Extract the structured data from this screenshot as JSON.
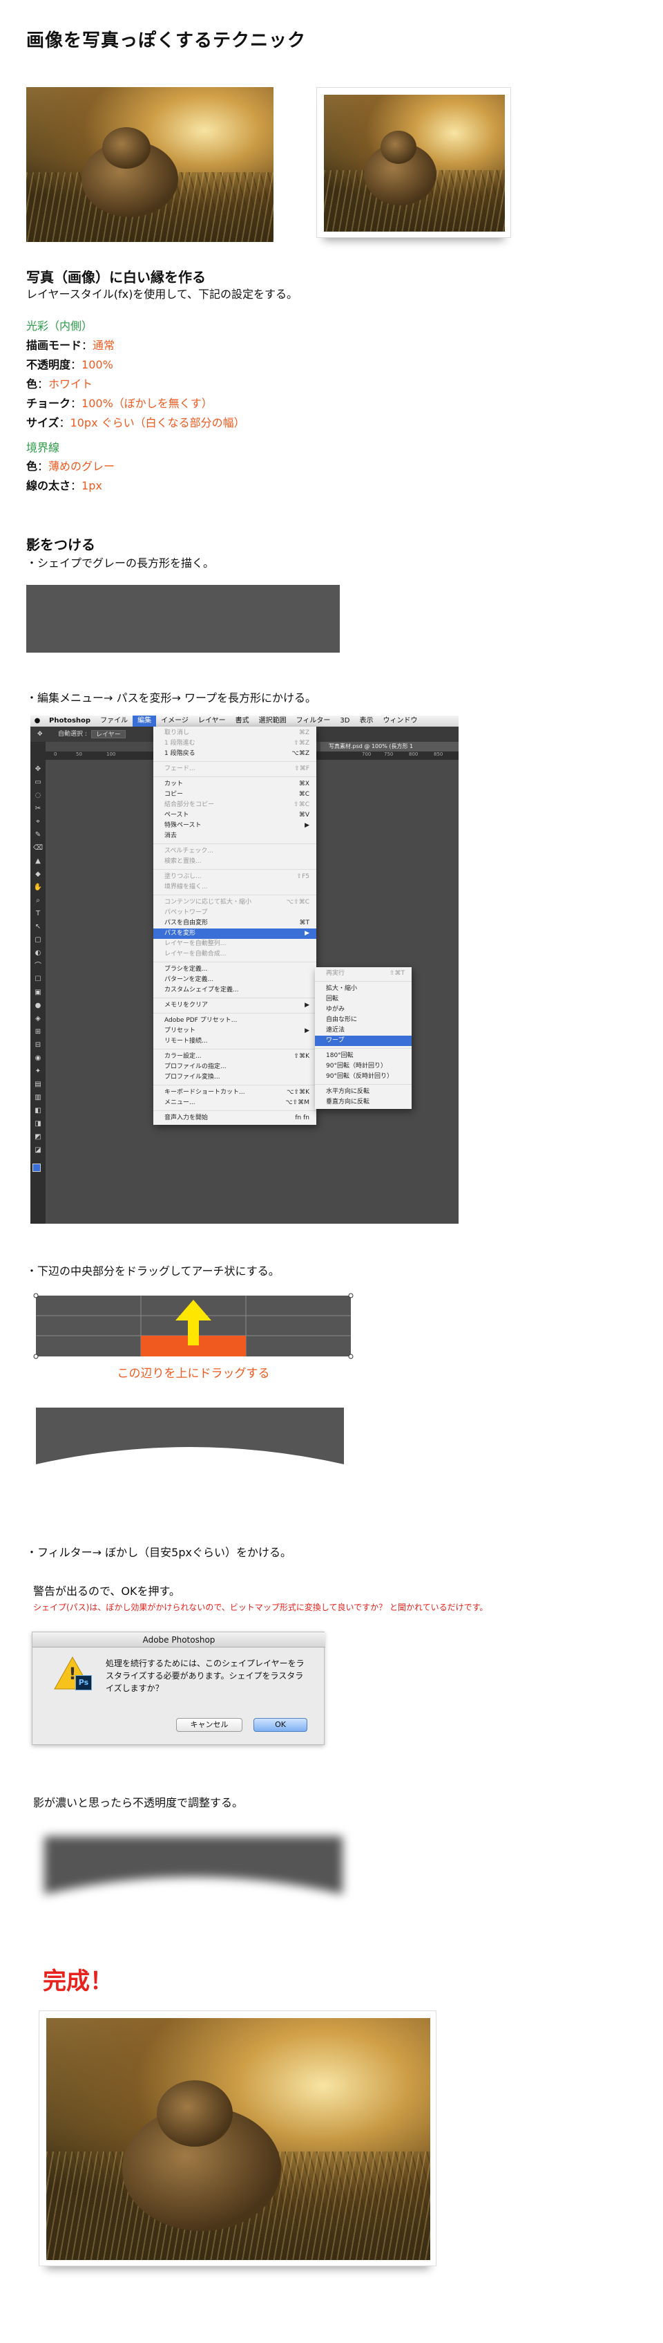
{
  "title": "画像を写真っぽくするテクニック",
  "sec1": {
    "heading": "写真（画像）に白い縁を作る",
    "intro": "レイヤースタイル(fx)を使用して、下記の設定をする。",
    "group1_title": "光彩（内側）",
    "rows1": [
      {
        "label": "描画モード",
        "value": "通常"
      },
      {
        "label": "不透明度",
        "value": "100%"
      },
      {
        "label": "色",
        "value": "ホワイト"
      },
      {
        "label": "チョーク",
        "value": "100%（ぼかしを無くす）"
      },
      {
        "label": "サイズ",
        "value": "10px ぐらい（白くなる部分の幅）"
      }
    ],
    "group2_title": "境界線",
    "rows2": [
      {
        "label": "色",
        "value": "薄めのグレー"
      },
      {
        "label": "線の太さ",
        "value": "1px"
      }
    ],
    "colon": "："
  },
  "sec2": {
    "heading": "影をつける",
    "step1": "・シェイプでグレーの長方形を描く。",
    "step2": "・編集メニュー→ パスを変形→ ワープを長方形にかける。",
    "step3": "・下辺の中央部分をドラッグしてアーチ状にする。",
    "drag_label": "この辺りを上にドラッグする",
    "step4": "・フィルター→ ぼかし（目安5pxぐらい）をかける。",
    "warn1": "警告が出るので、OKを押す。",
    "warn2": "シェイプ(パス)は、ぼかし効果がかけられないので、ビットマップ形式に変換して良いですか？ と聞かれているだけです。",
    "step5": "影が濃いと思ったら不透明度で調整する。",
    "done": "完成！"
  },
  "ps": {
    "menubar": [
      "Photoshop",
      "ファイル",
      "編集",
      "イメージ",
      "レイヤー",
      "書式",
      "選択範囲",
      "フィルター",
      "3D",
      "表示",
      "ウィンドウ"
    ],
    "doc_tab": "写真素材.psd @ 100% (長方形 1",
    "options_label": "自動選択 :",
    "options_value": "レイヤー",
    "ruler": [
      "0",
      "50",
      "100",
      "700",
      "750",
      "800",
      "850"
    ],
    "edit_menu": [
      {
        "label": "取り消し",
        "key": "⌘Z",
        "dim": true
      },
      {
        "label": "1 段階進む",
        "key": "⇧⌘Z",
        "dim": true
      },
      {
        "label": "1 段階戻る",
        "key": "⌥⌘Z",
        "dim": false
      },
      {
        "sep": true
      },
      {
        "label": "フェード...",
        "key": "⇧⌘F",
        "dim": true
      },
      {
        "sep": true
      },
      {
        "label": "カット",
        "key": "⌘X",
        "dim": false
      },
      {
        "label": "コピー",
        "key": "⌘C",
        "dim": false
      },
      {
        "label": "結合部分をコピー",
        "key": "⇧⌘C",
        "dim": true
      },
      {
        "label": "ペースト",
        "key": "⌘V",
        "dim": false
      },
      {
        "label": "特殊ペースト",
        "key": "▶",
        "dim": false
      },
      {
        "label": "消去",
        "key": "",
        "dim": false
      },
      {
        "sep": true
      },
      {
        "label": "スペルチェック...",
        "key": "",
        "dim": true
      },
      {
        "label": "検索と置換...",
        "key": "",
        "dim": true
      },
      {
        "sep": true
      },
      {
        "label": "塗りつぶし...",
        "key": "⇧F5",
        "dim": true
      },
      {
        "label": "境界線を描く...",
        "key": "",
        "dim": true
      },
      {
        "sep": true
      },
      {
        "label": "コンテンツに応じて拡大・縮小",
        "key": "⌥⇧⌘C",
        "dim": true
      },
      {
        "label": "パペットワープ",
        "key": "",
        "dim": true
      },
      {
        "label": "パスを自由変形",
        "key": "⌘T",
        "dim": false
      },
      {
        "label": "パスを変形",
        "key": "▶",
        "dim": false,
        "sel": true
      },
      {
        "label": "レイヤーを自動整列...",
        "key": "",
        "dim": true
      },
      {
        "label": "レイヤーを自動合成...",
        "key": "",
        "dim": true
      },
      {
        "sep": true
      },
      {
        "label": "ブラシを定義...",
        "key": "",
        "dim": false
      },
      {
        "label": "パターンを定義...",
        "key": "",
        "dim": false
      },
      {
        "label": "カスタムシェイプを定義...",
        "key": "",
        "dim": false
      },
      {
        "sep": true
      },
      {
        "label": "メモリをクリア",
        "key": "▶",
        "dim": false
      },
      {
        "sep": true
      },
      {
        "label": "Adobe PDF プリセット...",
        "key": "",
        "dim": false
      },
      {
        "label": "プリセット",
        "key": "▶",
        "dim": false
      },
      {
        "label": "リモート接続...",
        "key": "",
        "dim": false
      },
      {
        "sep": true
      },
      {
        "label": "カラー設定...",
        "key": "⇧⌘K",
        "dim": false
      },
      {
        "label": "プロファイルの指定...",
        "key": "",
        "dim": false
      },
      {
        "label": "プロファイル変換...",
        "key": "",
        "dim": false
      },
      {
        "sep": true
      },
      {
        "label": "キーボードショートカット...",
        "key": "⌥⇧⌘K",
        "dim": false
      },
      {
        "label": "メニュー...",
        "key": "⌥⇧⌘M",
        "dim": false
      },
      {
        "sep": true
      },
      {
        "label": "音声入力を開始",
        "key": "fn fn",
        "dim": false
      }
    ],
    "submenu": [
      {
        "label": "再実行",
        "key": "⇧⌘T",
        "dim": true
      },
      {
        "sep": true
      },
      {
        "label": "拡大・縮小",
        "key": "",
        "dim": false
      },
      {
        "label": "回転",
        "key": "",
        "dim": false
      },
      {
        "label": "ゆがみ",
        "key": "",
        "dim": false
      },
      {
        "label": "自由な形に",
        "key": "",
        "dim": false
      },
      {
        "label": "遠近法",
        "key": "",
        "dim": false
      },
      {
        "label": "ワープ",
        "key": "",
        "dim": false,
        "sel": true
      },
      {
        "sep": true
      },
      {
        "label": "180°回転",
        "key": "",
        "dim": false
      },
      {
        "label": "90°回転（時計回り）",
        "key": "",
        "dim": false
      },
      {
        "label": "90°回転（反時計回り）",
        "key": "",
        "dim": false
      },
      {
        "sep": true
      },
      {
        "label": "水平方向に反転",
        "key": "",
        "dim": false
      },
      {
        "label": "垂直方向に反転",
        "key": "",
        "dim": false
      }
    ]
  },
  "dialog": {
    "title": "Adobe Photoshop",
    "message": "処理を続行するためには、このシェイプレイヤーをラスタライズする必要があります。シェイプをラスタライズしますか？",
    "cancel": "キャンセル",
    "ok": "OK",
    "ps_badge": "Ps",
    "warning_glyph": "!"
  },
  "colors": {
    "heading_text": "#111111",
    "group_title": "#2a9c47",
    "value_orange": "#f05a1e",
    "done_red": "#e8211d",
    "shape_grey": "#555555",
    "ps_menu_selected": "#3b6fd8",
    "arrow_yellow": "#ffe600"
  }
}
